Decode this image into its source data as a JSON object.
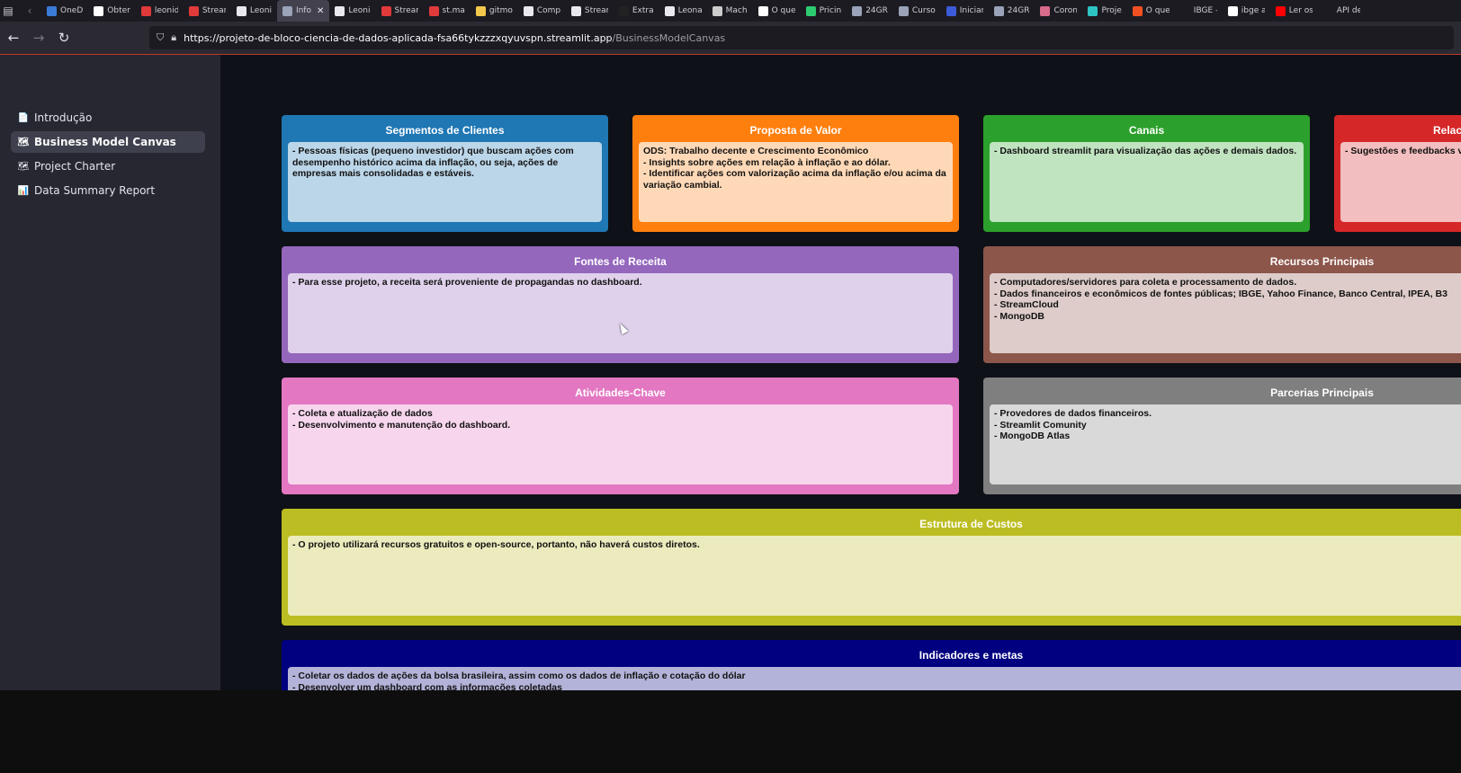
{
  "browser": {
    "tabs": [
      {
        "label": "OneD",
        "icon": "onedrive-icon",
        "color": "#3b7bd8"
      },
      {
        "label": "Obter",
        "icon": "app-icon",
        "color": "#ffffff"
      },
      {
        "label": "leonid",
        "icon": "streamlit-icon",
        "color": "#e03a3a"
      },
      {
        "label": "Stream",
        "icon": "streamlit-icon",
        "color": "#e03a3a"
      },
      {
        "label": "Leoni",
        "icon": "github-icon",
        "color": "#e8e8ee"
      },
      {
        "label": "Info",
        "icon": "page-icon",
        "color": "#9aa3b8",
        "active": true
      },
      {
        "label": "Leoni",
        "icon": "github-icon",
        "color": "#e8e8ee"
      },
      {
        "label": "Stream",
        "icon": "streamlit-icon",
        "color": "#e03a3a"
      },
      {
        "label": "st.ma",
        "icon": "streamlit-icon",
        "color": "#e03a3a"
      },
      {
        "label": "gitmo",
        "icon": "emoji-icon",
        "color": "#f2c94c"
      },
      {
        "label": "Comp",
        "icon": "github-icon",
        "color": "#e8e8ee"
      },
      {
        "label": "Stream",
        "icon": "streamlit-icon",
        "color": "#e8e8ee"
      },
      {
        "label": "Extra",
        "icon": "dot-icon",
        "color": "#222222"
      },
      {
        "label": "Leona",
        "icon": "github-icon",
        "color": "#e8e8ee"
      },
      {
        "label": "Mach",
        "icon": "mk-icon",
        "color": "#cccccc"
      },
      {
        "label": "O que",
        "icon": "medium-icon",
        "color": "#ffffff"
      },
      {
        "label": "Pricin",
        "icon": "leaf-icon",
        "color": "#2ecc71"
      },
      {
        "label": "24GR",
        "icon": "globe-icon",
        "color": "#9aa3b8"
      },
      {
        "label": "Curso",
        "icon": "globe-icon",
        "color": "#9aa3b8"
      },
      {
        "label": "Iniciar",
        "icon": "zm-icon",
        "color": "#3b5bd8"
      },
      {
        "label": "24GR",
        "icon": "globe-icon",
        "color": "#9aa3b8"
      },
      {
        "label": "Coron",
        "icon": "circle-icon",
        "color": "#d86a8a"
      },
      {
        "label": "Proje",
        "icon": "person-icon",
        "color": "#2ec4c4"
      },
      {
        "label": "O que",
        "icon": "windows-icon",
        "color": "#f25022"
      },
      {
        "label": "IBGE - API",
        "icon": "none",
        "color": "#1c1b22"
      },
      {
        "label": "ibge a",
        "icon": "google-icon",
        "color": "#ffffff"
      },
      {
        "label": "Ler os",
        "icon": "youtube-icon",
        "color": "#ff0000"
      },
      {
        "label": "API de",
        "icon": "none",
        "color": "#1c1b22"
      }
    ],
    "url_host": "https://projeto-de-bloco-ciencia-de-dados-aplicada-fsa66tykzzzxqyuvspn.streamlit.app",
    "url_path": "/BusinessModelCanvas"
  },
  "sidebar": {
    "items": [
      {
        "label": "Introdução",
        "icon": "📄"
      },
      {
        "label": "Business Model Canvas",
        "icon": "🗺"
      },
      {
        "label": "Project Charter",
        "icon": "🗺"
      },
      {
        "label": "Data Summary Report",
        "icon": "📊"
      }
    ]
  },
  "canvas": {
    "segmentos": {
      "title": "Segmentos de Clientes",
      "items": [
        "- Pessoas físicas (pequeno investidor) que buscam ações com desempenho histórico acima da inflação, ou seja, ações de empresas mais consolidadas e estáveis."
      ]
    },
    "proposta": {
      "title": "Proposta de Valor",
      "items": [
        "ODS: Trabalho decente e Crescimento Econômico",
        "- Insights sobre ações em relação à inflação e ao dólar.",
        "- Identificar ações com valorização acima da inflação e/ou acima da variação cambial."
      ]
    },
    "canais": {
      "title": "Canais",
      "items": [
        "- Dashboard streamlit para visualização das ações e demais dados."
      ]
    },
    "relacionamento": {
      "title": "Relacio",
      "items": [
        "- Sugestões e feedbacks via e"
      ]
    },
    "receita": {
      "title": "Fontes de Receita",
      "items": [
        "- Para esse projeto, a receita será proveniente de propagandas no dashboard."
      ]
    },
    "recursos": {
      "title": "Recursos Principais",
      "items": [
        "- Computadores/servidores para coleta e processamento de dados.",
        "- Dados financeiros e econômicos de fontes públicas; IBGE, Yahoo Finance, Banco Central, IPEA, B3",
        "- StreamCloud",
        "- MongoDB"
      ]
    },
    "atividades": {
      "title": "Atividades-Chave",
      "items": [
        "- Coleta e atualização de dados",
        "- Desenvolvimento e manutenção do dashboard."
      ]
    },
    "parcerias": {
      "title": "Parcerias Principais",
      "items": [
        "- Provedores de dados financeiros.",
        "- Streamlit Comunity",
        "- MongoDB Atlas"
      ]
    },
    "custos": {
      "title": "Estrutura de Custos",
      "items": [
        "- O projeto utilizará recursos gratuitos e open-source, portanto, não haverá custos diretos."
      ]
    },
    "indicadores": {
      "title": "Indicadores e metas",
      "items": [
        "- Coletar os dados de ações da bolsa brasileira, assim como os dados de inflação e cotação do dólar",
        "- Desenvolver um dashboard com as informações coletadas"
      ]
    }
  },
  "colors": {
    "segmentos": "#1f77b4",
    "proposta": "#ff7f0e",
    "canais": "#2ca02c",
    "relacionamento": "#d62728",
    "receita": "#9467bd",
    "recursos": "#8c564b",
    "atividades": "#e377c2",
    "parcerias": "#7f7f7f",
    "custos": "#bcbd22",
    "indicadores": "#000080"
  }
}
